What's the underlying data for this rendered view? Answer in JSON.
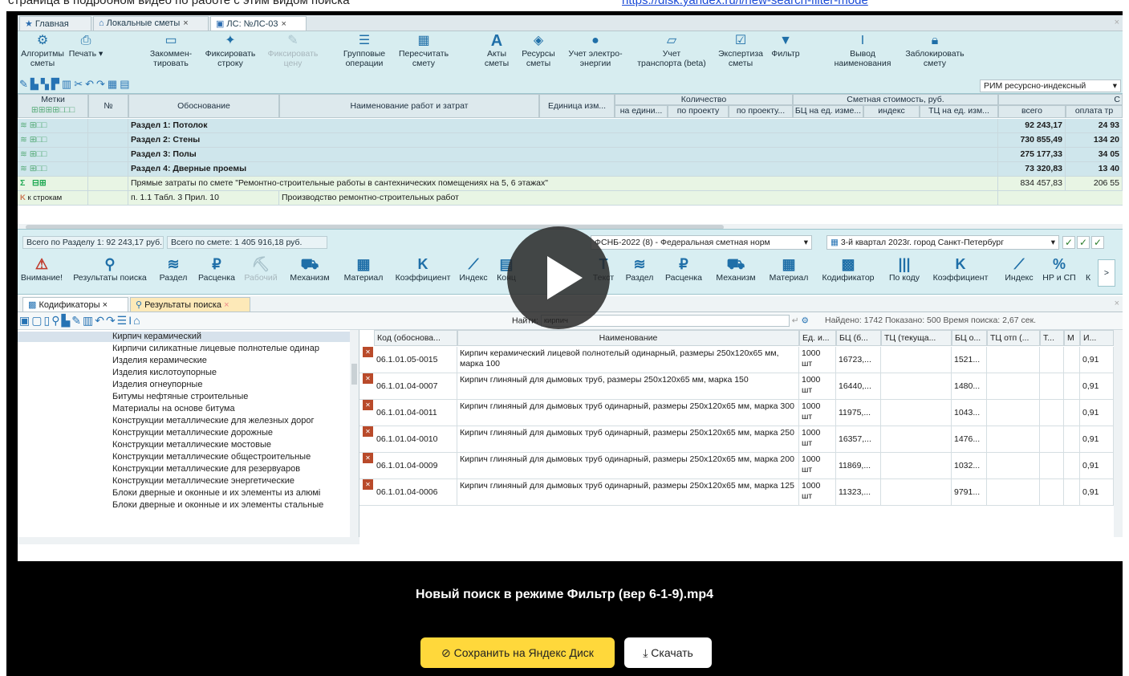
{
  "page_top_text": "страница в подробном видео по работе с этим видом поиска",
  "page_top_link": "https://disk.yandex.ru/i/new-search-filter-mode",
  "tabs": [
    {
      "label": "Главная",
      "icon": "star-icon"
    },
    {
      "label": "Локальные сметы",
      "icon": "home-icon"
    },
    {
      "label": "ЛС: №ЛС-03",
      "icon": "document-icon",
      "active": true
    }
  ],
  "ribbon": {
    "algorithms": "Алгоритмы\nсметы",
    "print": "Печать",
    "comment": "Закоммен-\nтировать",
    "fix_row": "Фиксировать\nстроку",
    "fix_price": "Фиксировать\nцену",
    "group_ops": "Групповые\nоперации",
    "recalc": "Пересчитать\nсмету",
    "acts": "Акты\nсметы",
    "resources": "Ресурсы\nсметы",
    "energy": "Учет электро-\nэнергии",
    "transport": "Учет\nтранспорта (beta)",
    "expertise": "Экспертиза\nсметы",
    "filter": "Фильтр",
    "names": "Вывод\nнаименования",
    "lock": "Заблокировать\nсмету",
    "method_select": "РИМ ресурсно-индексный"
  },
  "grid": {
    "headers": {
      "marks": "Метки",
      "num": "№",
      "basis": "Обоснование",
      "name": "Наименование работ и затрат",
      "unit": "Единица изм...",
      "qty": "Количество",
      "qty_per_unit": "на едини...",
      "qty_project1": "по проекту",
      "qty_project2": "по проекту...",
      "cost": "Сметная стоимость, руб.",
      "bc_unit": "БЦ на ед. изме...",
      "index": "индекс",
      "tc_unit": "ТЦ на ед. изм...",
      "total": "всего",
      "pay": "оплата тр",
      "c": "С"
    },
    "rows": [
      {
        "name": "Раздел 1: Потолок",
        "total": "92 243,17",
        "pay": "24 93"
      },
      {
        "name": "Раздел 2: Стены",
        "total": "730 855,49",
        "pay": "134 20"
      },
      {
        "name": "Раздел 3: Полы",
        "total": "275 177,33",
        "pay": "34 05"
      },
      {
        "name": "Раздел 4: Дверные проемы",
        "total": "73 320,83",
        "pay": "13 40"
      }
    ],
    "sum_row": {
      "name": "Прямые затраты по смете \"Ремонтно-строительные работы в сантехнических помещениях на 5, 6 этажах\"",
      "total": "834 457,83",
      "pay": "206 55"
    },
    "k_row": {
      "label": "к строкам",
      "basis": "п. 1.1 Табл. 3 Прил. 10",
      "name": "Производство ремонтно-строительных работ"
    }
  },
  "status": {
    "section_total": "Всего по Разделу 1: 92 243,17 руб.",
    "estimate_total": "Всего по смете: 1 405 916,18 руб.",
    "norm_base": "ФСНБ-2022 (8) - Федеральная сметная норм",
    "period": "3-й квартал 2023г. город Санкт-Петербург"
  },
  "ribbon2": [
    {
      "label": "Внимание!",
      "icon": "warning-icon",
      "glyph": "⚠"
    },
    {
      "label": "Результаты поиска",
      "icon": "search-icon",
      "glyph": "⚲"
    },
    {
      "label": "Раздел",
      "icon": "stack-icon",
      "glyph": "≋"
    },
    {
      "label": "Расценка",
      "icon": "ruble-icon",
      "glyph": "₽"
    },
    {
      "label": "Рабочий",
      "icon": "worker-icon",
      "glyph": "⛏",
      "disabled": true
    },
    {
      "label": "Механизм",
      "icon": "car-icon",
      "glyph": "⛟"
    },
    {
      "label": "Материал",
      "icon": "grid-icon",
      "glyph": "▦"
    },
    {
      "label": "Коэффициент",
      "icon": "k-icon",
      "glyph": "K"
    },
    {
      "label": "Индекс",
      "icon": "chart-icon",
      "glyph": "⟋"
    },
    {
      "label": "Конц",
      "icon": "doc-icon",
      "glyph": "▤"
    },
    {
      "label": "Текст",
      "icon": "text-icon",
      "glyph": "T"
    },
    {
      "label": "Раздел",
      "icon": "stack-icon",
      "glyph": "≋"
    },
    {
      "label": "Расценка",
      "icon": "ruble-icon",
      "glyph": "₽"
    },
    {
      "label": "Механизм",
      "icon": "car-icon",
      "glyph": "⛟"
    },
    {
      "label": "Материал",
      "icon": "grid-icon",
      "glyph": "▦"
    },
    {
      "label": "Кодификатор",
      "icon": "codifier-icon",
      "glyph": "▩"
    },
    {
      "label": "По коду",
      "icon": "barcode-icon",
      "glyph": "|||"
    },
    {
      "label": "Коэффициент",
      "icon": "k-icon",
      "glyph": "K"
    },
    {
      "label": "Индекс",
      "icon": "chart-icon",
      "glyph": "⟋"
    },
    {
      "label": "НР и СП",
      "icon": "percent-icon",
      "glyph": "%"
    },
    {
      "label": "К",
      "icon": "k-icon",
      "glyph": ""
    }
  ],
  "bottom_tabs": [
    {
      "label": "Кодификаторы",
      "icon": "codifier-icon"
    },
    {
      "label": "Результаты поиска",
      "icon": "search-icon"
    }
  ],
  "search": {
    "find_label": "Найти:",
    "query": "кирпич",
    "found": "Найдено: 1742  Показано: 500  Время поиска: 2,67 сек."
  },
  "tree": [
    "Кирпич керамический",
    "Кирпичи силикатные лицевые полнотелые одинар",
    "Изделия керамические",
    "Изделия кислотоупорные",
    "Изделия огнеупорные",
    "Битумы нефтяные строительные",
    "Материалы на основе битума",
    "Конструкции металлические для железных дорог",
    "Конструкции металлические дорожные",
    "Конструкции металлические мостовые",
    "Конструкции металлические общестроительные",
    "Конструкции металлические для резервуаров",
    "Конструкции металлические энергетические",
    "Блоки дверные и оконные и их элементы из алюмі",
    "Блоки дверные и оконные и их элементы стальные"
  ],
  "results": {
    "headers": [
      "",
      "Код (обоснова...",
      "Наименование",
      "Ед. и...",
      "БЦ (б...",
      "ТЦ (текуща...",
      "БЦ о...",
      "ТЦ отп (...",
      "Т...",
      "М",
      "И..."
    ],
    "rows": [
      {
        "code": "06.1.01.05-0015",
        "name": "Кирпич керамический лицевой полнотелый одинарный, размеры 250х120х65 мм, марка 100",
        "unit": "1000 шт",
        "bc": "16723,...",
        "bco": "1521...",
        "i": "0,91"
      },
      {
        "code": "06.1.01.04-0007",
        "name": "Кирпич глиняный для дымовых труб, размеры 250х120х65 мм, марка 150",
        "unit": "1000 шт",
        "bc": "16440,...",
        "bco": "1480...",
        "i": "0,91"
      },
      {
        "code": "06.1.01.04-0011",
        "name": "Кирпич глиняный для дымовых труб одинарный, размеры 250х120х65 мм, марка 300",
        "unit": "1000 шт",
        "bc": "11975,...",
        "bco": "1043...",
        "i": "0,91"
      },
      {
        "code": "06.1.01.04-0010",
        "name": "Кирпич глиняный для дымовых труб одинарный, размеры 250х120х65 мм, марка 250",
        "unit": "1000 шт",
        "bc": "16357,...",
        "bco": "1476...",
        "i": "0,91"
      },
      {
        "code": "06.1.01.04-0009",
        "name": "Кирпич глиняный для дымовых труб одинарный, размеры 250х120х65 мм, марка 200",
        "unit": "1000 шт",
        "bc": "11869,...",
        "bco": "1032...",
        "i": "0,91"
      },
      {
        "code": "06.1.01.04-0006",
        "name": "Кирпич глиняный для дымовых труб одинарный, размеры 250х120х65 мм, марка 125",
        "unit": "1000 шт",
        "bc": "11323,...",
        "bco": "9791...",
        "i": "0,91"
      }
    ]
  },
  "video": {
    "title": "Новый поиск в режиме Фильтр (вер 6-1-9).mp4",
    "save_button": "Сохранить на Яндекс Диск",
    "download_button": "Скачать"
  }
}
